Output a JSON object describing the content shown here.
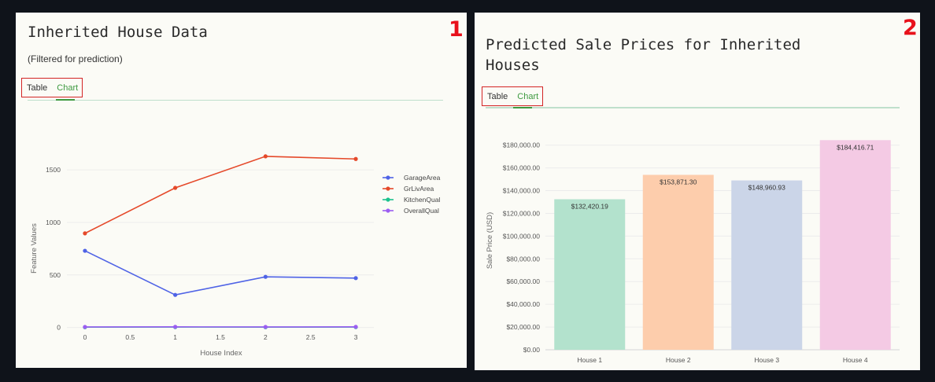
{
  "panel1": {
    "badge": "1",
    "title": "Inherited House Data",
    "subtitle": "(Filtered for prediction)",
    "tabs": [
      {
        "label": "Table"
      },
      {
        "label": "Chart"
      }
    ],
    "chart_data": {
      "type": "line",
      "title": "",
      "xlabel": "House Index",
      "ylabel": "Feature Values",
      "x": [
        0,
        1,
        2,
        3
      ],
      "xticks": [
        "0",
        "0.5",
        "1",
        "1.5",
        "2",
        "2.5",
        "3"
      ],
      "yticks": [
        "0",
        "500",
        "1000",
        "1500"
      ],
      "xlim": [
        -0.2,
        3.2
      ],
      "ylim": [
        -100,
        1950
      ],
      "grid": true,
      "legend_position": "right",
      "series": [
        {
          "name": "GarageArea",
          "values": [
            730,
            310,
            482,
            470
          ],
          "color": "#4f63e6"
        },
        {
          "name": "GrLivArea",
          "values": [
            896,
            1329,
            1629,
            1604
          ],
          "color": "#e5492a"
        },
        {
          "name": "KitchenQual",
          "values": [
            3,
            4,
            3,
            4
          ],
          "color": "#1cc28e"
        },
        {
          "name": "OverallQual",
          "values": [
            5,
            6,
            5,
            6
          ],
          "color": "#9c5df2"
        }
      ]
    }
  },
  "panel2": {
    "badge": "2",
    "title": "Predicted Sale Prices for Inherited Houses",
    "tabs": [
      {
        "label": "Table"
      },
      {
        "label": "Chart"
      }
    ],
    "chart_data": {
      "type": "bar",
      "title": "",
      "xlabel": "",
      "ylabel": "Sale Price (USD)",
      "categories": [
        "House 1",
        "House 2",
        "House 3",
        "House 4"
      ],
      "values": [
        132420.19,
        153871.3,
        148960.93,
        184416.71
      ],
      "value_labels": [
        "$132,420.19",
        "$153,871.30",
        "$148,960.93",
        "$184,416.71"
      ],
      "colors": [
        "#b3e2cd",
        "#fdcdac",
        "#cbd5e8",
        "#f4cae4"
      ],
      "yticks": [
        "$0.00",
        "$20,000.00",
        "$40,000.00",
        "$60,000.00",
        "$80,000.00",
        "$100,000.00",
        "$120,000.00",
        "$140,000.00",
        "$160,000.00",
        "$180,000.00"
      ],
      "ytick_values": [
        0,
        20000,
        40000,
        60000,
        80000,
        100000,
        120000,
        140000,
        160000,
        180000
      ],
      "ylim": [
        0,
        186000
      ],
      "grid": true
    }
  }
}
